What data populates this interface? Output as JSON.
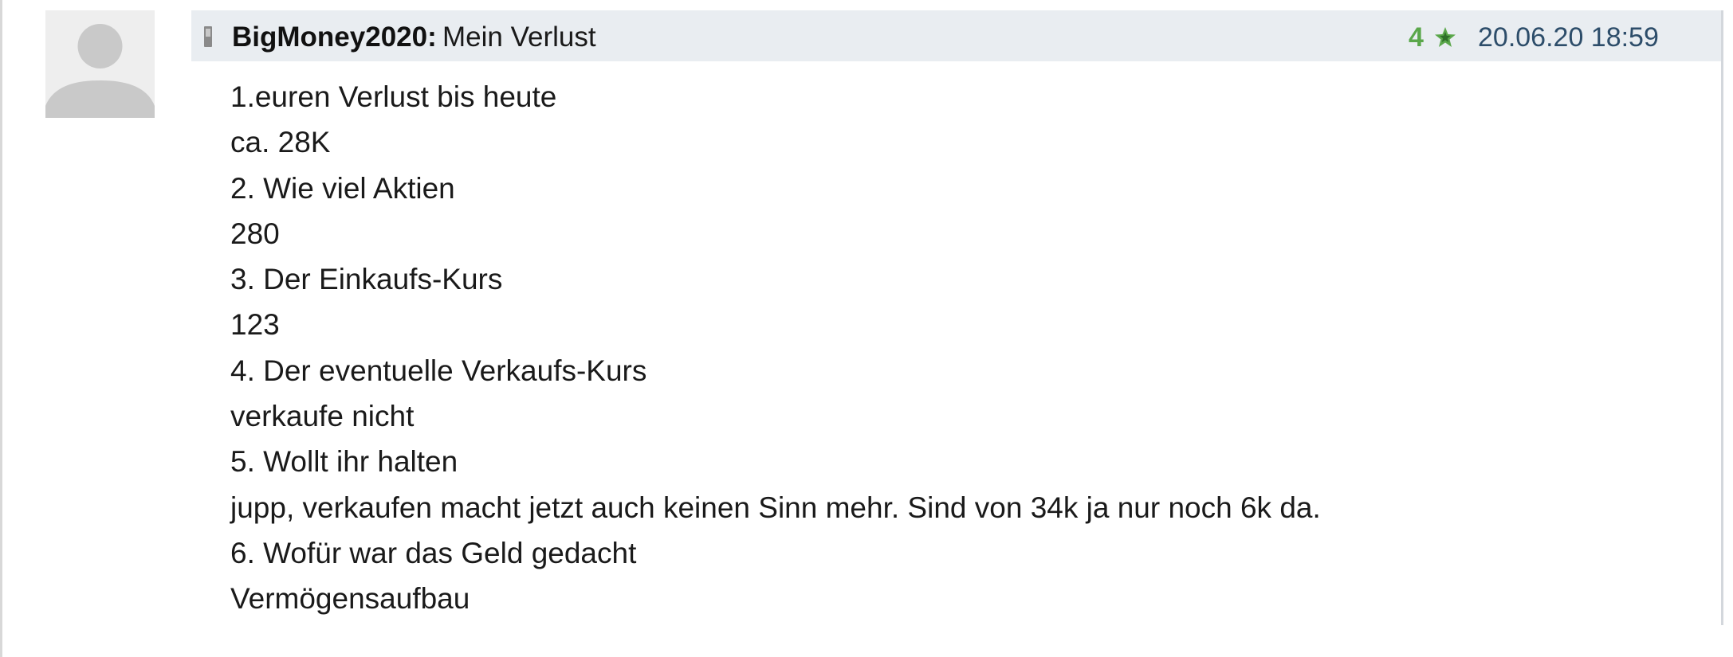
{
  "post": {
    "author": "BigMoney2020:",
    "title": "Mein Verlust",
    "rating": "4",
    "timestamp": "20.06.20 18:59",
    "lines": [
      "1.euren Verlust bis heute",
      "ca. 28K",
      "2. Wie viel Aktien",
      "280",
      "3. Der Einkaufs-Kurs",
      "123",
      "4. Der eventuelle Verkaufs-Kurs",
      "verkaufe nicht",
      "5. Wollt ihr halten",
      "jupp, verkaufen macht jetzt auch keinen Sinn mehr. Sind von 34k ja nur noch 6k da.",
      "6. Wofür war das Geld gedacht",
      "Vermögensaufbau"
    ]
  },
  "icons": {
    "avatar": "avatar-placeholder-icon",
    "device": "mobile-phone-icon",
    "rating": "star-icon"
  },
  "colors": {
    "header_background": "#e9edf1",
    "rating": "#5aa74a",
    "timestamp": "#2d4d6a"
  }
}
